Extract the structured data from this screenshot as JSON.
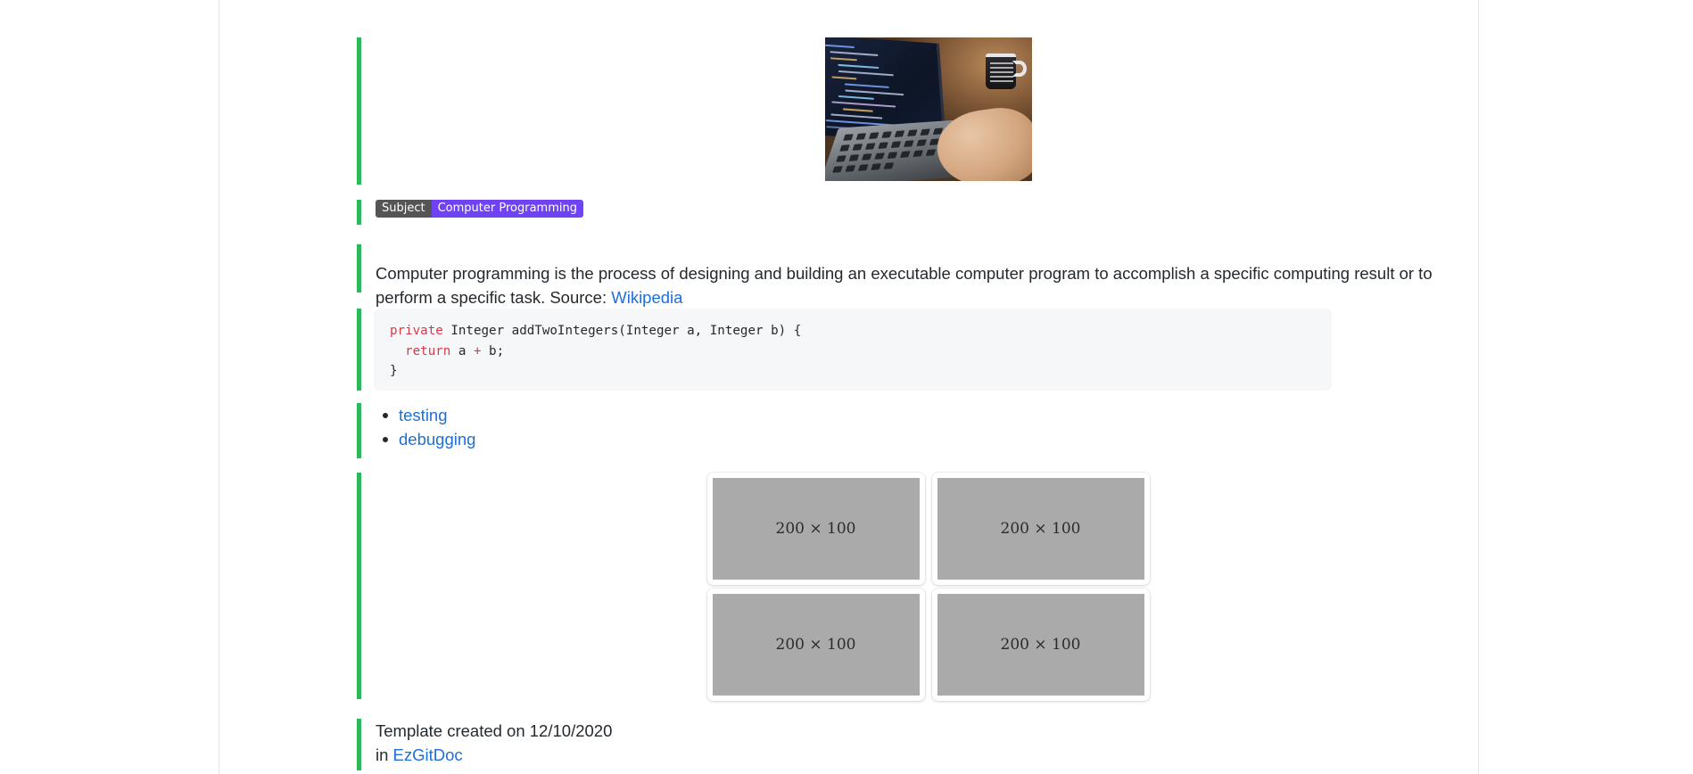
{
  "document": {
    "accent_color": "#2eb85c",
    "link_color": "#1e6fd9",
    "text_color": "#24292e"
  },
  "hero": {
    "alt": "hands typing code on a laptop beside a keep-calm mug"
  },
  "badge": {
    "label": "Subject",
    "value": "Computer Programming",
    "label_color": "#555555",
    "value_color": "#6f42f5"
  },
  "paragraph": {
    "text_before_link": "Computer programming is the process of designing and building an executable computer program to accomplish a specific computing result or to perform a specific task. Source: ",
    "link_text": "Wikipedia"
  },
  "code": {
    "language": "java",
    "line1_kw": "private",
    "line1_rest": " Integer addTwoIntegers(Integer a, Integer b) {",
    "line2_indent": "  ",
    "line2_kw": "return",
    "line2_a": " a ",
    "line2_op": "+",
    "line2_b": " b;",
    "line3": "}"
  },
  "list": {
    "items": [
      {
        "label": "testing"
      },
      {
        "label": "debugging"
      }
    ]
  },
  "image_grid": {
    "cards": [
      {
        "caption": "200 × 100"
      },
      {
        "caption": "200 × 100"
      },
      {
        "caption": "200 × 100"
      },
      {
        "caption": "200 × 100"
      }
    ]
  },
  "footer": {
    "line1": "Template created on 12/10/2020",
    "line2_prefix": "in ",
    "link_text": "EzGitDoc"
  }
}
